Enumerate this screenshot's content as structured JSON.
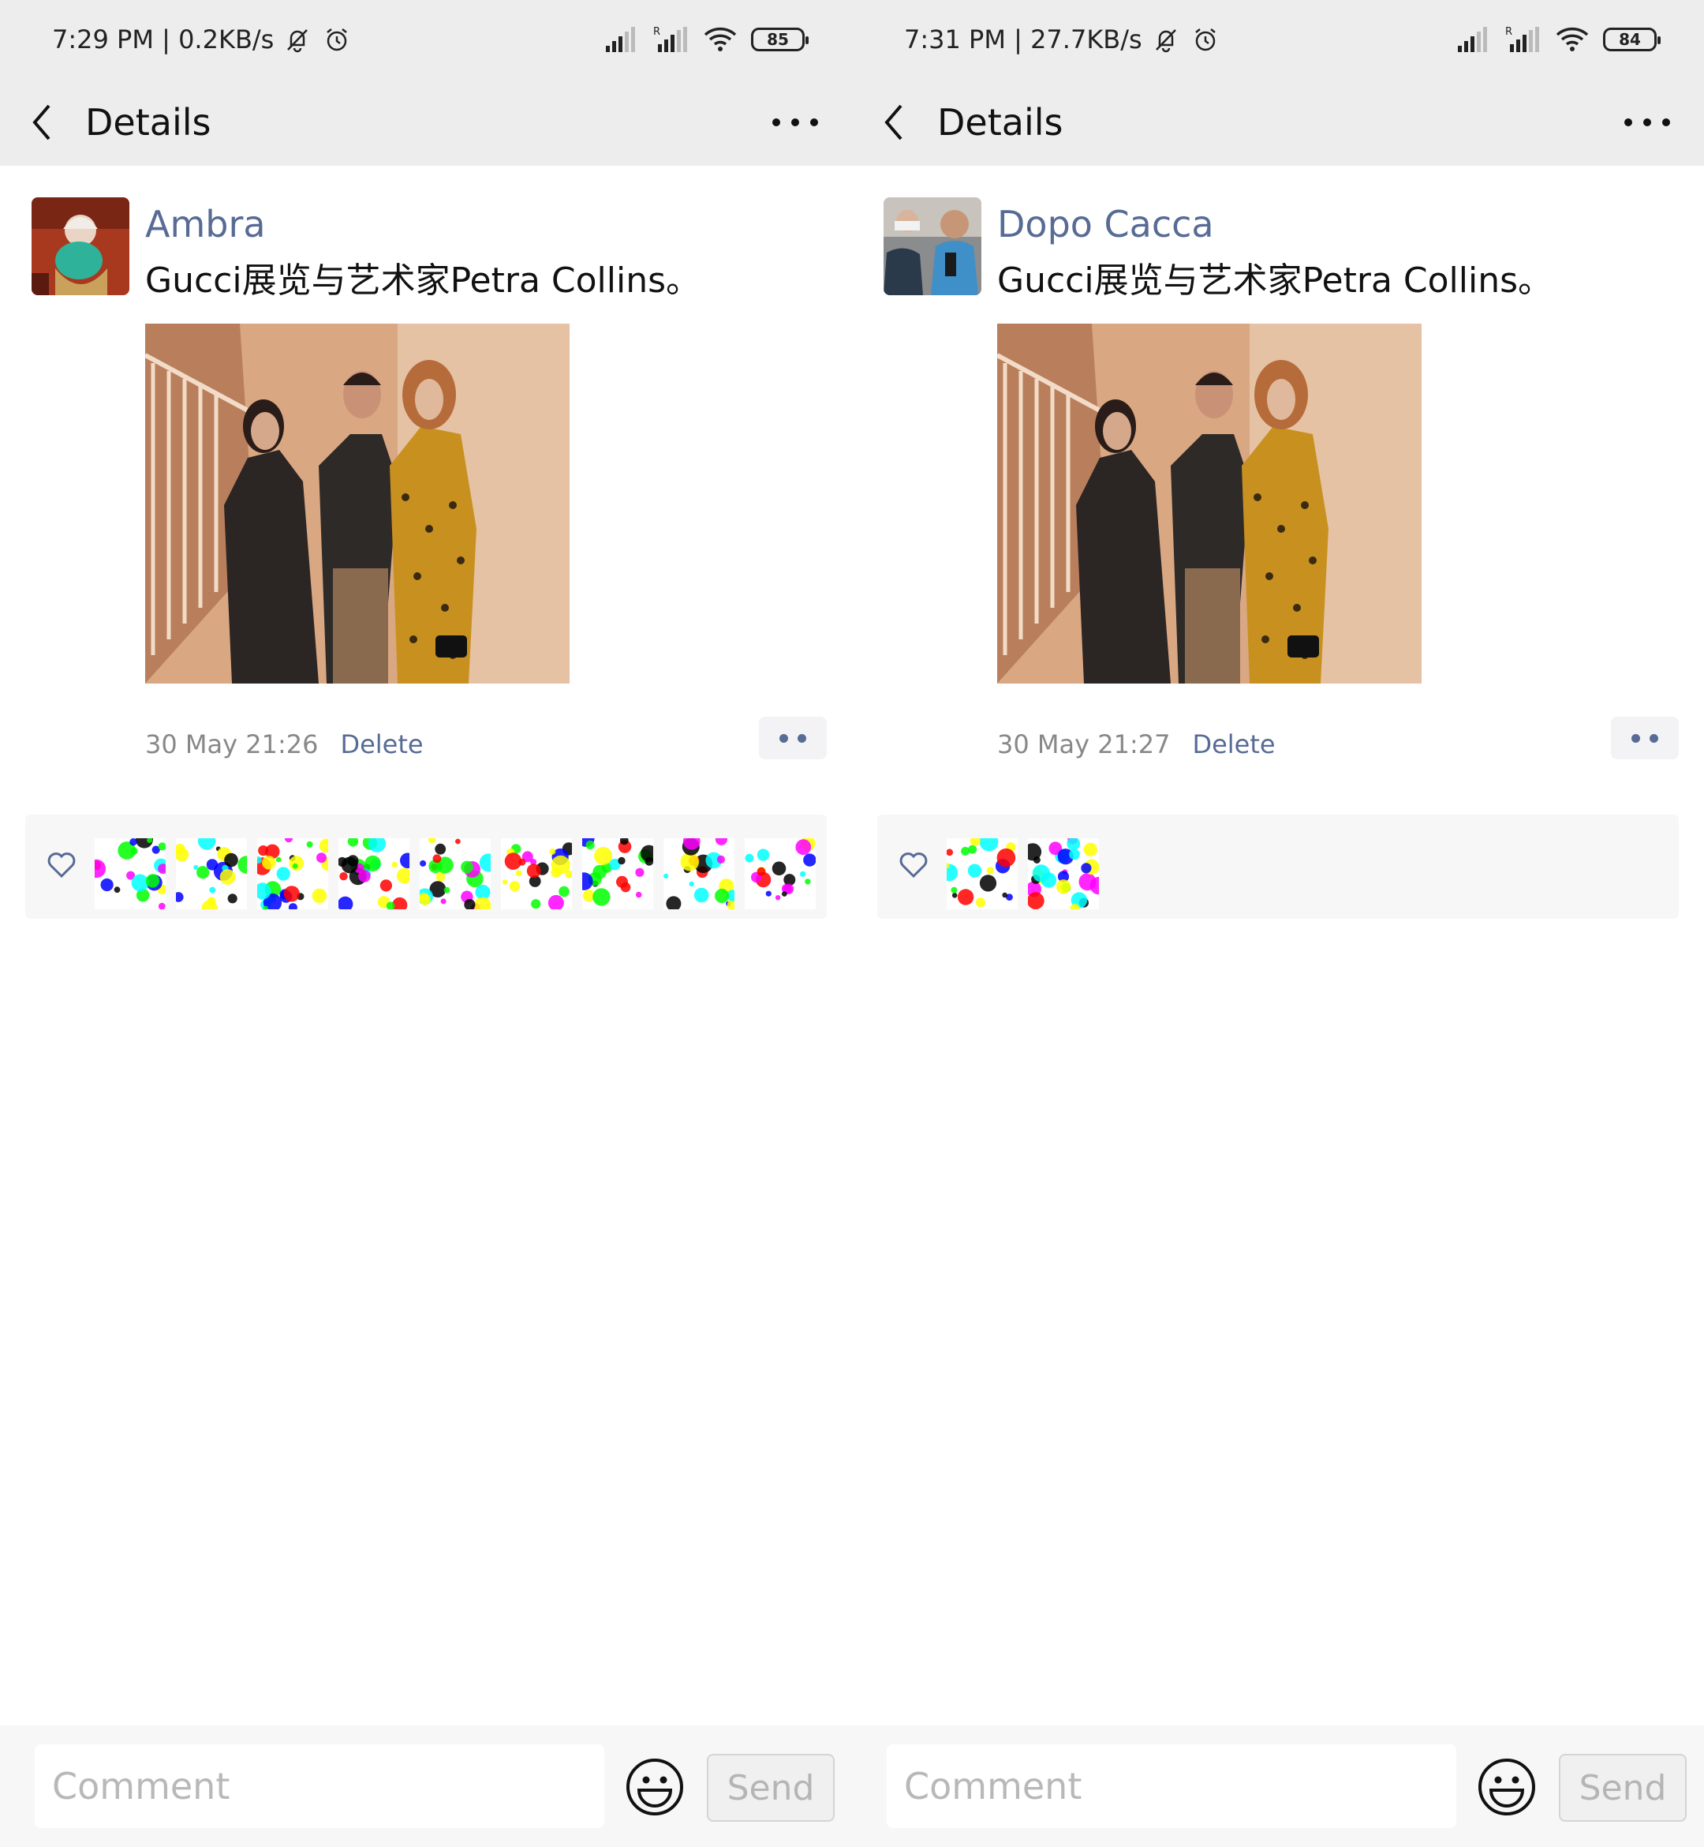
{
  "screens": [
    {
      "status": {
        "time_speed": "7:29 PM | 0.2KB/s",
        "battery": "85"
      },
      "nav": {
        "title": "Details"
      },
      "post": {
        "author": "Ambra",
        "caption": "Gucci展览与艺术家Petra Collins。",
        "timestamp": "30 May 21:26",
        "delete_label": "Delete",
        "likers_count": 9
      },
      "composer": {
        "placeholder": "Comment",
        "send_label": "Send"
      }
    },
    {
      "status": {
        "time_speed": "7:31 PM | 27.7KB/s",
        "battery": "84"
      },
      "nav": {
        "title": "Details"
      },
      "post": {
        "author": "Dopo Cacca",
        "caption": "Gucci展览与艺术家Petra Collins。",
        "timestamp": "30 May 21:27",
        "delete_label": "Delete",
        "likers_count": 2
      },
      "composer": {
        "placeholder": "Comment",
        "send_label": "Send"
      }
    }
  ],
  "icons": {
    "back": "chevron-left-icon",
    "more": "more-horizontal-icon",
    "heart": "heart-outline-icon",
    "emoji": "smiley-icon",
    "mute": "bell-off-icon",
    "alarm": "alarm-clock-icon",
    "signal": "cellular-signal-icon",
    "wifi": "wifi-icon"
  },
  "colors": {
    "link": "#576b95",
    "header_bg": "#ededed",
    "meta_gray": "#888888",
    "likes_bg": "#f7f7f7"
  }
}
